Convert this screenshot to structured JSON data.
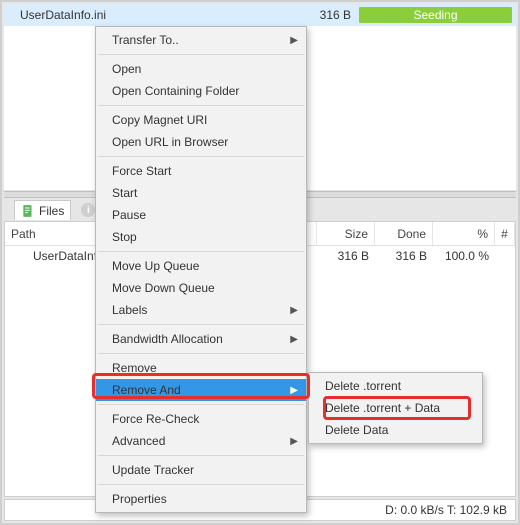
{
  "torrent_row": {
    "name": "UserDataInfo.ini",
    "size": "316 B",
    "status": "Seeding"
  },
  "tabs": {
    "files_label": "Files",
    "info_symbol": "i"
  },
  "table": {
    "headers": {
      "path": "Path",
      "size": "Size",
      "done": "Done",
      "pct": "%",
      "last": "#"
    },
    "row0": {
      "path": "UserDataInfo.ini",
      "size": "316 B",
      "done": "316 B",
      "pct": "100.0 %"
    }
  },
  "statusbar": "D: 0.0 kB/s T: 102.9 kB",
  "menu": {
    "transfer_to": "Transfer To..",
    "open": "Open",
    "open_containing": "Open Containing Folder",
    "copy_magnet": "Copy Magnet URI",
    "open_url": "Open URL in Browser",
    "force_start": "Force Start",
    "start": "Start",
    "pause": "Pause",
    "stop": "Stop",
    "move_up": "Move Up Queue",
    "move_down": "Move Down Queue",
    "labels": "Labels",
    "bandwidth": "Bandwidth Allocation",
    "remove": "Remove",
    "remove_and": "Remove And",
    "force_recheck": "Force Re-Check",
    "advanced": "Advanced",
    "update_tracker": "Update Tracker",
    "properties": "Properties"
  },
  "submenu": {
    "del_torrent": "Delete .torrent",
    "del_torrent_data": "Delete .torrent + Data",
    "del_data": "Delete Data"
  },
  "glyphs": {
    "submenu_arrow": "▶"
  }
}
